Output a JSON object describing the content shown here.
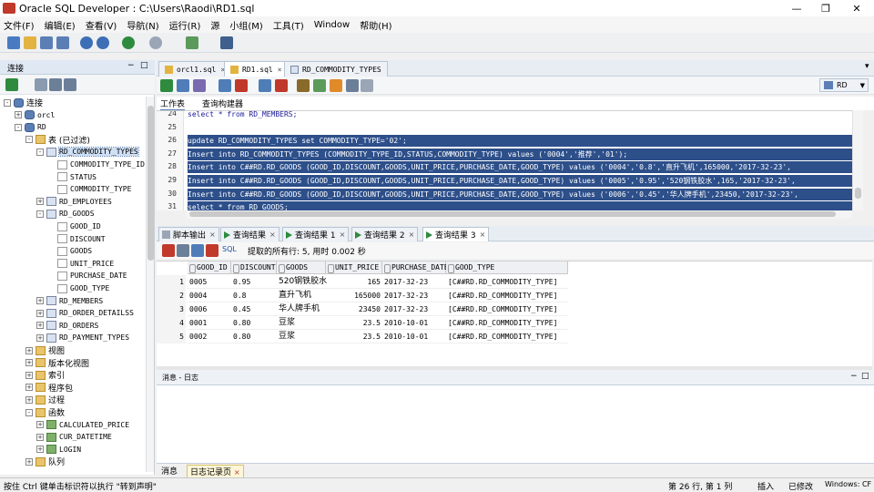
{
  "window": {
    "title": "Oracle SQL Developer : C:\\Users\\Raodi\\RD1.sql"
  },
  "menu": [
    "文件(F)",
    "编辑(E)",
    "查看(V)",
    "导航(N)",
    "运行(R)",
    "源",
    "小组(M)",
    "工具(T)",
    "Window",
    "帮助(H)"
  ],
  "navigator": {
    "title": "连接",
    "tree": [
      {
        "label": "连接",
        "indent": 0,
        "icon": "db",
        "exp": "-",
        "cjk": true
      },
      {
        "label": "orcl",
        "indent": 1,
        "icon": "db",
        "exp": "+"
      },
      {
        "label": "RD",
        "indent": 1,
        "icon": "db",
        "exp": "-"
      },
      {
        "label": "表 (已过滤)",
        "indent": 2,
        "icon": "folder",
        "exp": "-",
        "cjk": true
      },
      {
        "label": "RD_COMMODITY_TYPES",
        "indent": 3,
        "icon": "tbl",
        "exp": "-",
        "selected": true
      },
      {
        "label": "COMMODITY_TYPE_ID",
        "indent": 4,
        "icon": "col"
      },
      {
        "label": "STATUS",
        "indent": 4,
        "icon": "col"
      },
      {
        "label": "COMMODITY_TYPE",
        "indent": 4,
        "icon": "col"
      },
      {
        "label": "RD_EMPLOYEES",
        "indent": 3,
        "icon": "tbl",
        "exp": "+"
      },
      {
        "label": "RD_GOODS",
        "indent": 3,
        "icon": "tbl",
        "exp": "-"
      },
      {
        "label": "GOOD_ID",
        "indent": 4,
        "icon": "col"
      },
      {
        "label": "DISCOUNT",
        "indent": 4,
        "icon": "col"
      },
      {
        "label": "GOODS",
        "indent": 4,
        "icon": "col"
      },
      {
        "label": "UNIT_PRICE",
        "indent": 4,
        "icon": "col"
      },
      {
        "label": "PURCHASE_DATE",
        "indent": 4,
        "icon": "col"
      },
      {
        "label": "GOOD_TYPE",
        "indent": 4,
        "icon": "col"
      },
      {
        "label": "RD_MEMBERS",
        "indent": 3,
        "icon": "tbl",
        "exp": "+"
      },
      {
        "label": "RD_ORDER_DETAILSS",
        "indent": 3,
        "icon": "tbl",
        "exp": "+"
      },
      {
        "label": "RD_ORDERS",
        "indent": 3,
        "icon": "tbl",
        "exp": "+"
      },
      {
        "label": "RD_PAYMENT_TYPES",
        "indent": 3,
        "icon": "tbl",
        "exp": "+"
      },
      {
        "label": "视图",
        "indent": 2,
        "icon": "folder",
        "exp": "+",
        "cjk": true
      },
      {
        "label": "版本化视图",
        "indent": 2,
        "icon": "folder",
        "exp": "+",
        "cjk": true
      },
      {
        "label": "索引",
        "indent": 2,
        "icon": "folder",
        "exp": "+",
        "cjk": true
      },
      {
        "label": "程序包",
        "indent": 2,
        "icon": "folder",
        "exp": "+",
        "cjk": true
      },
      {
        "label": "过程",
        "indent": 2,
        "icon": "folder",
        "exp": "+",
        "cjk": true
      },
      {
        "label": "函数",
        "indent": 2,
        "icon": "folder",
        "exp": "-",
        "cjk": true
      },
      {
        "label": "CALCULATED_PRICE",
        "indent": 3,
        "icon": "fn",
        "exp": "+"
      },
      {
        "label": "CUR_DATETIME",
        "indent": 3,
        "icon": "fn",
        "exp": "+"
      },
      {
        "label": "LOGIN",
        "indent": 3,
        "icon": "fn",
        "exp": "+"
      },
      {
        "label": "队列",
        "indent": 2,
        "icon": "folder",
        "exp": "+",
        "cjk": true
      }
    ]
  },
  "editor": {
    "tabs": [
      "orcl1.sql",
      "RD1.sql",
      "RD_COMMODITY_TYPES"
    ],
    "active_tab": 1,
    "subtabs": [
      "工作表",
      "查询构建器"
    ],
    "connection": "RD",
    "lines": [
      {
        "n": "24",
        "text": "select * from RD_MEMBERS;",
        "hl": false
      },
      {
        "n": "25",
        "text": "",
        "hl": false
      },
      {
        "n": "26",
        "text": "update RD_COMMODITY_TYPES set COMMODITY_TYPE='02';",
        "hl": true
      },
      {
        "n": "27",
        "text": "Insert into RD_COMMODITY_TYPES (COMMODITY_TYPE_ID,STATUS,COMMODITY_TYPE) values ('0004','推荐','01');",
        "hl": true
      },
      {
        "n": "28",
        "text": "Insert into C##RD.RD_GOODS (GOOD_ID,DISCOUNT,GOODS,UNIT_PRICE,PURCHASE_DATE,GOOD_TYPE) values ('0004','0.8','直升飞机',165000,'2017-32-23',",
        "hl": true
      },
      {
        "n": "29",
        "text": "Insert into C##RD.RD_GOODS (GOOD_ID,DISCOUNT,GOODS,UNIT_PRICE,PURCHASE_DATE,GOOD_TYPE) values ('0005','0.95','520钢铁胶水',165,'2017-32-23',",
        "hl": true
      },
      {
        "n": "30",
        "text": "Insert into C##RD.RD_GOODS (GOOD_ID,DISCOUNT,GOODS,UNIT_PRICE,PURCHASE_DATE,GOOD_TYPE) values ('0006','0.45','华人牌手机',23450,'2017-32-23',",
        "hl": true
      },
      {
        "n": "31",
        "text": "select * from RD_GOODS;",
        "hl": true
      }
    ]
  },
  "results": {
    "tabs": [
      "脚本输出",
      "查询结果",
      "查询结果 1",
      "查询结果 2",
      "查询结果 3"
    ],
    "active_tab": 4,
    "sql_label": "SQL",
    "status": "提取的所有行: 5, 用时 0.002 秒",
    "columns": [
      "GOOD_ID",
      "DISCOUNT",
      "GOODS",
      "UNIT_PRICE",
      "PURCHASE_DATE",
      "GOOD_TYPE"
    ],
    "rows": [
      [
        "1",
        "0005",
        "0.95",
        "520钢铁胶水",
        "165",
        "2017-32-23",
        "[C##RD.RD_COMMODITY_TYPE]"
      ],
      [
        "2",
        "0004",
        "0.8",
        "直升飞机",
        "165000",
        "2017-32-23",
        "[C##RD.RD_COMMODITY_TYPE]"
      ],
      [
        "3",
        "0006",
        "0.45",
        "华人牌手机",
        "23450",
        "2017-32-23",
        "[C##RD.RD_COMMODITY_TYPE]"
      ],
      [
        "4",
        "0001",
        "0.80",
        "豆浆",
        "23.5",
        "2010-10-01",
        "[C##RD.RD_COMMODITY_TYPE]"
      ],
      [
        "5",
        "0002",
        "0.80",
        "豆浆",
        "23.5",
        "2010-10-01",
        "[C##RD.RD_COMMODITY_TYPE]"
      ]
    ]
  },
  "messages": {
    "title": "消息 - 日志",
    "tabs": [
      "消息",
      "日志记录页"
    ]
  },
  "status": {
    "hint": "按住 Ctrl 键单击标识符以执行 \"转到声明\"",
    "position": "第 26 行, 第 1 列",
    "mode": "插入",
    "modified": "已修改",
    "eol": "Windows: CF"
  }
}
